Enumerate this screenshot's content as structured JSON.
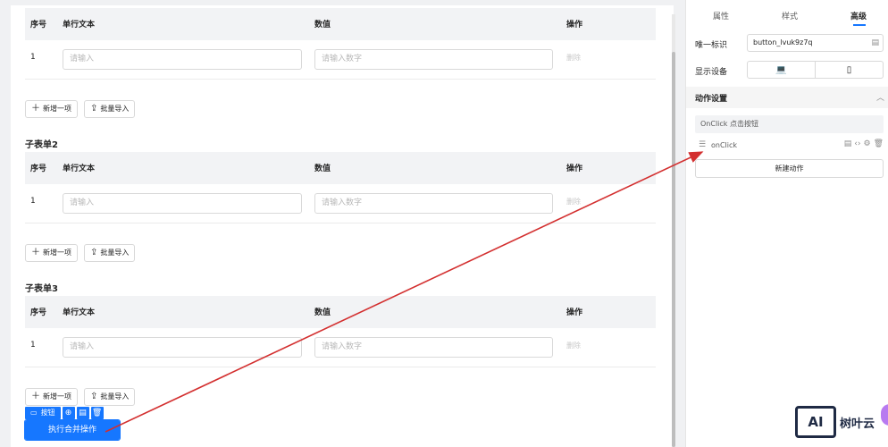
{
  "table": {
    "col_seq": "序号",
    "col_text": "单行文本",
    "col_value": "数值",
    "col_ops": "操作",
    "row_seq": "1",
    "placeholder_text": "请输入",
    "placeholder_number": "请输入数字",
    "delete_label": "删除"
  },
  "buttons": {
    "add_item": "新增一项",
    "batch_import": "批量导入",
    "add_icon": "plus-icon",
    "import_icon": "upload-icon"
  },
  "sections": {
    "sub2": "子表单2",
    "sub3": "子表单3"
  },
  "selection": {
    "tag_label": "按钮",
    "icons": [
      "button-type-icon",
      "copy-icon",
      "paste-icon",
      "delete-icon"
    ]
  },
  "exec_button": "执行合并操作",
  "panel": {
    "tabs": [
      "属性",
      "样式",
      "高级"
    ],
    "active_tab": "高级",
    "id_label": "唯一标识",
    "id_value": "button_lvuk9z7q",
    "device_label": "显示设备",
    "devices": [
      "laptop-icon",
      "mobile-icon"
    ],
    "section_title": "动作设置",
    "event_title": "OnClick 点击按钮",
    "action_name": "onClick",
    "new_action": "新建动作"
  },
  "logo": {
    "mark": "AI",
    "text": "树叶云"
  },
  "colors": {
    "primary": "#1677ff",
    "arrow": "#d32f2f",
    "header_bg": "#f2f3f5"
  }
}
